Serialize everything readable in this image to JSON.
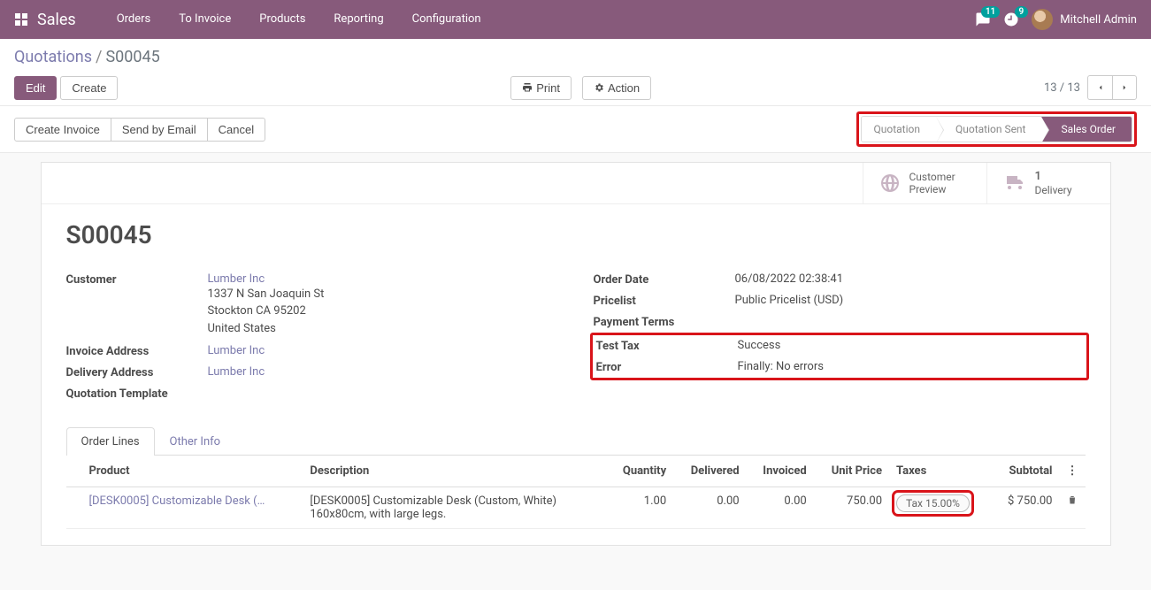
{
  "topnav": {
    "brand": "Sales",
    "menu": [
      "Orders",
      "To Invoice",
      "Products",
      "Reporting",
      "Configuration"
    ],
    "msg_count": "11",
    "activity_count": "9",
    "user": "Mitchell Admin"
  },
  "breadcrumb": {
    "root": "Quotations",
    "current": "S00045"
  },
  "buttons": {
    "edit": "Edit",
    "create": "Create",
    "print": "Print",
    "action": "Action",
    "create_invoice": "Create Invoice",
    "send_email": "Send by Email",
    "cancel": "Cancel"
  },
  "pager": "13 / 13",
  "stages": {
    "quotation": "Quotation",
    "sent": "Quotation Sent",
    "order": "Sales Order"
  },
  "statbtns": {
    "preview_l1": "Customer",
    "preview_l2": "Preview",
    "delivery_num": "1",
    "delivery_l2": "Delivery"
  },
  "form": {
    "title": "S00045",
    "customer_label": "Customer",
    "customer_link": "Lumber Inc",
    "addr1": "1337 N San Joaquin St",
    "addr2": "Stockton CA 95202",
    "addr3": "United States",
    "invoice_addr_label": "Invoice Address",
    "invoice_addr": "Lumber Inc",
    "delivery_addr_label": "Delivery Address",
    "delivery_addr": "Lumber Inc",
    "quotation_tmpl_label": "Quotation Template",
    "order_date_label": "Order Date",
    "order_date": "06/08/2022 02:38:41",
    "pricelist_label": "Pricelist",
    "pricelist": "Public Pricelist (USD)",
    "payment_terms_label": "Payment Terms",
    "test_tax_label": "Test Tax",
    "test_tax": "Success",
    "error_label": "Error",
    "error": "Finally: No errors"
  },
  "tabs": {
    "lines": "Order Lines",
    "other": "Other Info"
  },
  "table": {
    "headers": {
      "product": "Product",
      "description": "Description",
      "quantity": "Quantity",
      "delivered": "Delivered",
      "invoiced": "Invoiced",
      "unit_price": "Unit Price",
      "taxes": "Taxes",
      "subtotal": "Subtotal"
    },
    "row": {
      "product": "[DESK0005] Customizable Desk (…",
      "desc1": "[DESK0005] Customizable Desk (Custom, White)",
      "desc2": "160x80cm, with large legs.",
      "quantity": "1.00",
      "delivered": "0.00",
      "invoiced": "0.00",
      "unit_price": "750.00",
      "tax": "Tax 15.00%",
      "subtotal": "$ 750.00"
    }
  }
}
